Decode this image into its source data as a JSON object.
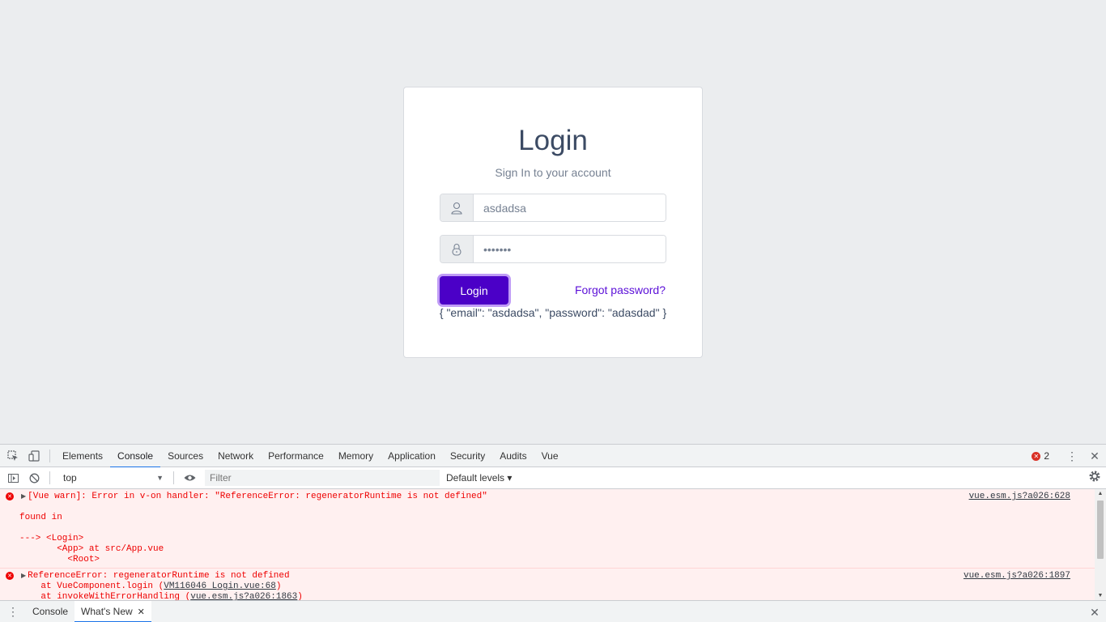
{
  "login": {
    "title": "Login",
    "subtitle": "Sign In to your account",
    "username_value": "asdadsa",
    "password_value": "•••••••",
    "login_label": "Login",
    "forgot_label": "Forgot password?",
    "debug_output": "{ \"email\": \"asdadsa\", \"password\": \"adasdad\" }"
  },
  "devtools": {
    "tabs": [
      "Elements",
      "Console",
      "Sources",
      "Network",
      "Performance",
      "Memory",
      "Application",
      "Security",
      "Audits",
      "Vue"
    ],
    "active_tab": "Console",
    "error_count": "2",
    "context": "top",
    "filter_placeholder": "Filter",
    "levels_label": "Default levels ▾",
    "messages": [
      {
        "lines": [
          "[Vue warn]: Error in v-on handler: \"ReferenceError: regeneratorRuntime is not defined\"",
          "",
          "found in",
          "",
          "---> <Login>",
          "       <App> at src/App.vue",
          "         <Root>"
        ],
        "source": "vue.esm.js?a026:628"
      },
      {
        "lines": [
          "ReferenceError: regeneratorRuntime is not defined",
          "    at VueComponent.login (",
          "    at invokeWithErrorHandling ("
        ],
        "link1": "VM116046 Login.vue:68",
        "link1_close": ")",
        "link2": "vue.esm.js?a026:1863",
        "link2_close": ")",
        "source": "vue.esm.js?a026:1897"
      }
    ],
    "drawer_tabs": [
      "Console",
      "What's New"
    ],
    "drawer_active": "What's New"
  },
  "colors": {
    "primary": "#4b00c7",
    "link": "#5b0fd8",
    "error": "#e00000",
    "page_bg": "#ebedef"
  }
}
